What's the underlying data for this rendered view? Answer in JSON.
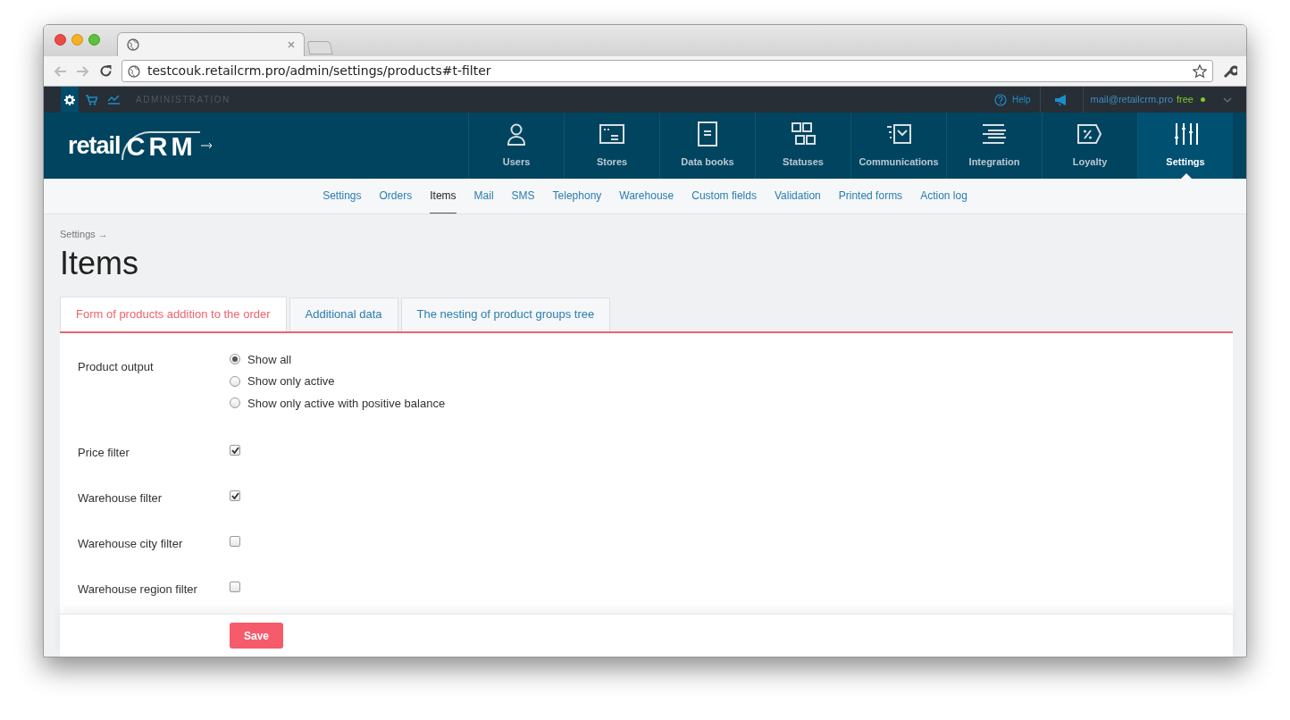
{
  "browser": {
    "url": "testcouk.retailcrm.pro/admin/settings/products#t-filter"
  },
  "admin_bar": {
    "label": "ADMINISTRATION",
    "help": "Help",
    "email": "mail@retailcrm.pro",
    "plan": "free"
  },
  "logo": {
    "text": "retail",
    "mark": "CRM"
  },
  "nav": [
    {
      "label": "Users",
      "selected": false
    },
    {
      "label": "Stores",
      "selected": false
    },
    {
      "label": "Data books",
      "selected": false
    },
    {
      "label": "Statuses",
      "selected": false
    },
    {
      "label": "Communications",
      "selected": false
    },
    {
      "label": "Integration",
      "selected": false
    },
    {
      "label": "Loyalty",
      "selected": false
    },
    {
      "label": "Settings",
      "selected": true
    }
  ],
  "subnav": [
    {
      "label": "Settings",
      "selected": false
    },
    {
      "label": "Orders",
      "selected": false
    },
    {
      "label": "Items",
      "selected": true
    },
    {
      "label": "Mail",
      "selected": false
    },
    {
      "label": "SMS",
      "selected": false
    },
    {
      "label": "Telephony",
      "selected": false
    },
    {
      "label": "Warehouse",
      "selected": false
    },
    {
      "label": "Custom fields",
      "selected": false
    },
    {
      "label": "Validation",
      "selected": false
    },
    {
      "label": "Printed forms",
      "selected": false
    },
    {
      "label": "Action log",
      "selected": false
    }
  ],
  "breadcrumb": "Settings →",
  "title": "Items",
  "tabs": [
    {
      "label": "Form of products addition to the order",
      "selected": true
    },
    {
      "label": "Additional data",
      "selected": false
    },
    {
      "label": "The nesting of product groups tree",
      "selected": false
    }
  ],
  "product_output": {
    "label": "Product output",
    "options": [
      {
        "label": "Show all",
        "selected": true
      },
      {
        "label": "Show only active",
        "selected": false
      },
      {
        "label": "Show only active with positive balance",
        "selected": false
      }
    ]
  },
  "filters": [
    {
      "label": "Price filter",
      "checked": true
    },
    {
      "label": "Warehouse filter",
      "checked": true
    },
    {
      "label": "Warehouse city filter",
      "checked": false
    },
    {
      "label": "Warehouse region filter",
      "checked": false
    }
  ],
  "save_button": "Save"
}
